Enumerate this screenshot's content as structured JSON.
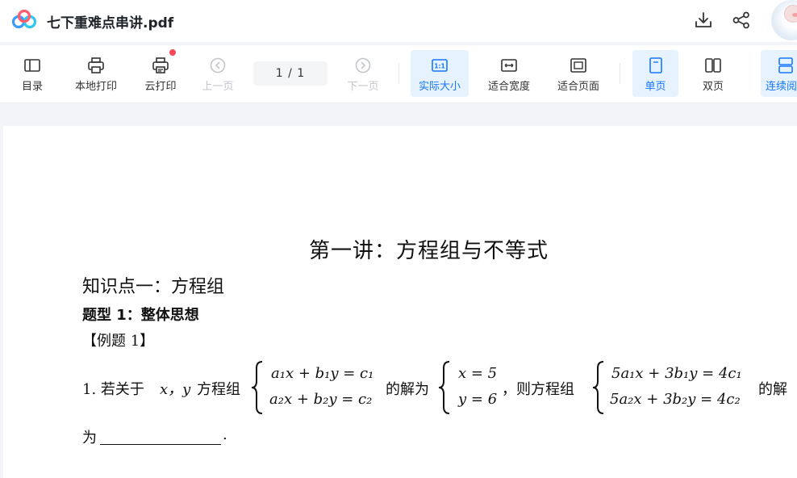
{
  "header": {
    "file_name": "七下重难点串讲.pdf"
  },
  "toolbar": {
    "outline": "目录",
    "local_print": "本地打印",
    "cloud_print": "云打印",
    "prev_page": "上一页",
    "page_indicator": "1  /  1",
    "next_page": "下一页",
    "actual_size": "实际大小",
    "fit_width": "适合宽度",
    "fit_page": "适合页面",
    "single_page": "单页",
    "double_page": "双页",
    "continuous": "连续阅"
  },
  "document": {
    "heading": "第一讲：方程组与不等式",
    "section": "知识点一：方程组",
    "subsection": "题型 1：整体思想",
    "example_label": "【例题 1】",
    "q_prefix": "1. 若关于",
    "q_vars": "x，y",
    "q_group": "方程组",
    "eq1": "a₁x + b₁y = c₁",
    "eq2": "a₂x + b₂y = c₂",
    "sol_text": "的解为",
    "sol1": "x = 5",
    "sol2": "y = 6",
    "then_text": "，则方程组",
    "eq3": "5a₁x + 3b₁y = 4c₁",
    "eq4": "5a₂x + 3b₂y = 4c₂",
    "end_text": "的解",
    "wei": "为",
    "period": "."
  }
}
